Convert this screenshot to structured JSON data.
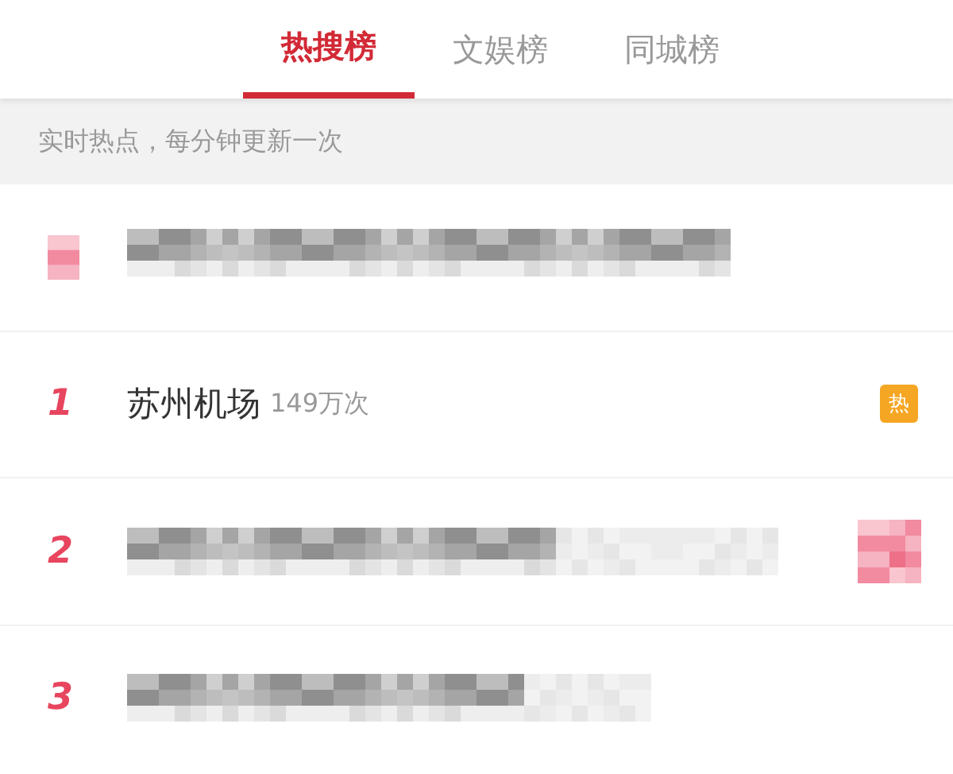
{
  "tabs": [
    {
      "label": "热搜榜",
      "selected": true
    },
    {
      "label": "文娱榜",
      "selected": false
    },
    {
      "label": "同城榜",
      "selected": false
    }
  ],
  "notice": "实时热点，每分钟更新一次",
  "rows": [
    {
      "kind": "pinned"
    },
    {
      "kind": "item",
      "rank": "1",
      "title": "苏州机场",
      "count": "149万次",
      "badge": "热"
    },
    {
      "kind": "redacted",
      "rank": "2",
      "redacted_badge": true
    },
    {
      "kind": "redacted",
      "rank": "3",
      "redacted_badge": false
    }
  ]
}
